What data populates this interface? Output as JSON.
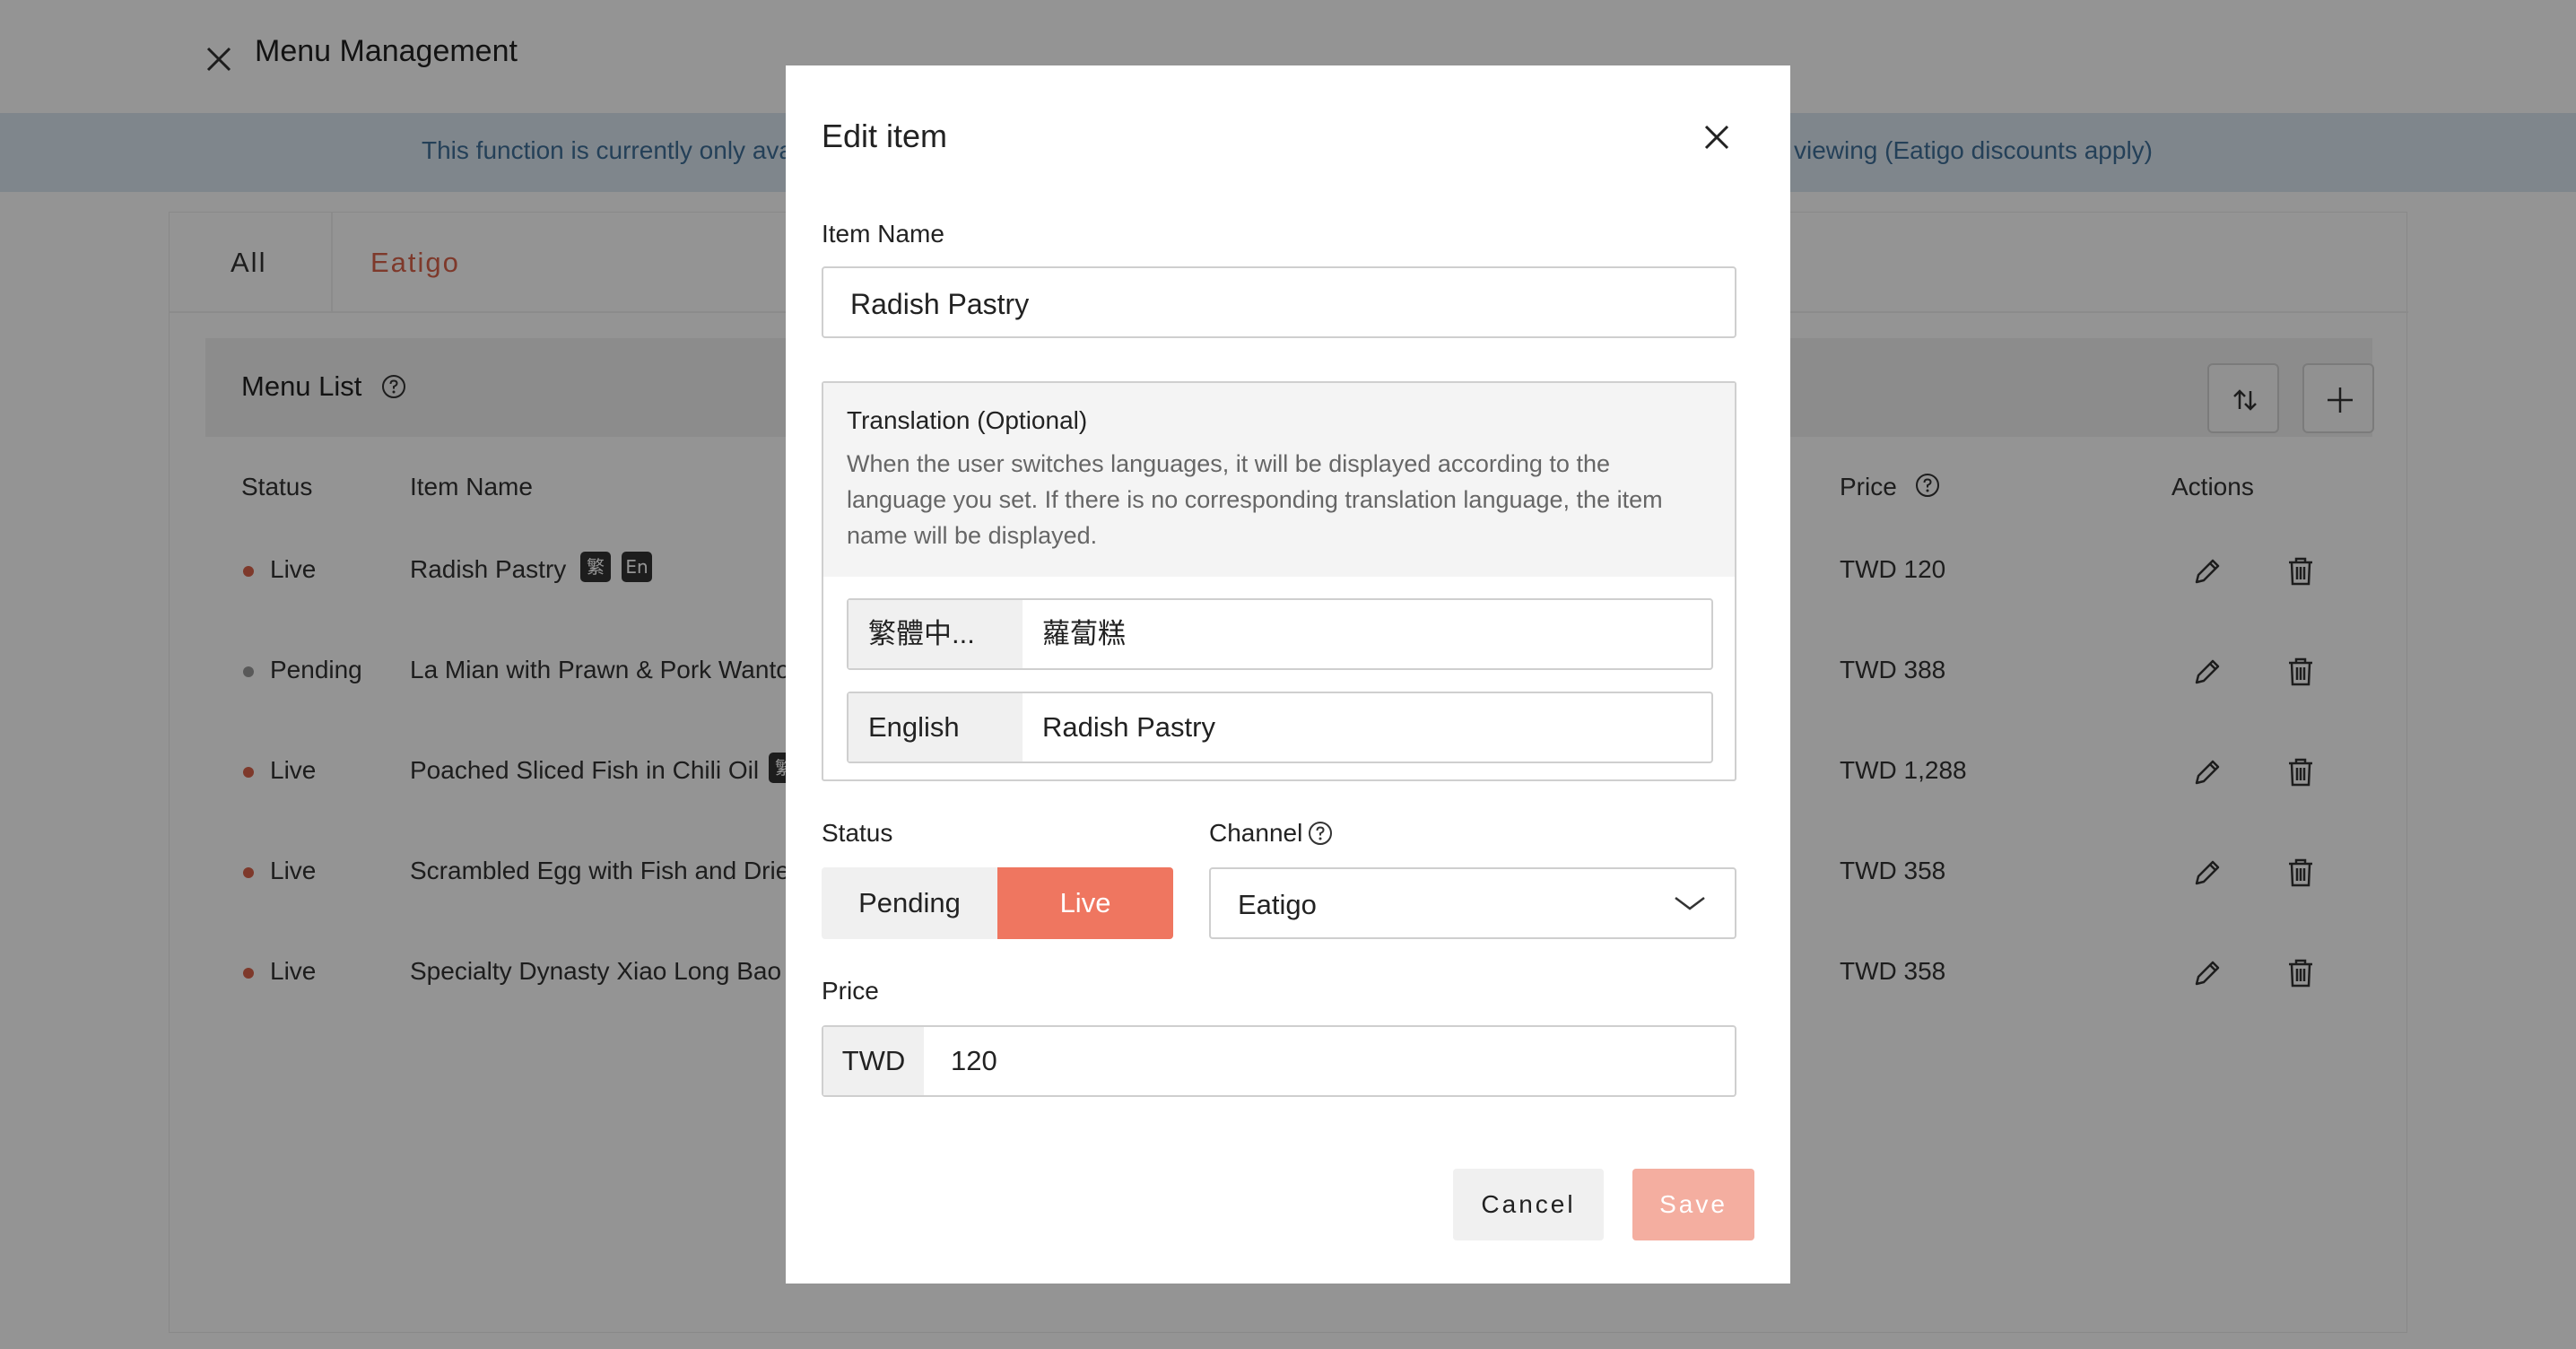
{
  "app": {
    "title": "Menu Management",
    "notice_left": "This function is currently only ava",
    "notice_right": "viewing (Eatigo discounts apply)"
  },
  "tabs": [
    {
      "label": "All"
    },
    {
      "label": "Eatigo"
    }
  ],
  "menu_list": {
    "label": "Menu List",
    "columns": {
      "status": "Status",
      "item_name": "Item Name",
      "price": "Price",
      "actions": "Actions"
    },
    "rows": [
      {
        "status": "Live",
        "name": "Radish Pastry",
        "price": "TWD 120",
        "badges": [
          "繁",
          "En"
        ]
      },
      {
        "status": "Pending",
        "name": "La Mian with Prawn & Pork Wanto",
        "price": "TWD 388",
        "badges": []
      },
      {
        "status": "Live",
        "name": "Poached Sliced Fish in Chili Oil",
        "price": "TWD 1,288",
        "badges": [
          "繁"
        ]
      },
      {
        "status": "Live",
        "name": "Scrambled Egg with Fish and Dried",
        "price": "TWD 358",
        "badges": []
      },
      {
        "status": "Live",
        "name": "Specialty Dynasty Xiao Long Bao (",
        "price": "TWD 358",
        "badges": []
      }
    ]
  },
  "modal": {
    "title": "Edit item",
    "item_name_label": "Item Name",
    "item_name_value": "Radish Pastry",
    "translation": {
      "title": "Translation (Optional)",
      "description": "When the user switches languages, it will be displayed according to the language you set. If there is no corresponding translation language, the item name will be displayed.",
      "entries": [
        {
          "language": "繁體中...",
          "value": "蘿蔔糕"
        },
        {
          "language": "English",
          "value": "Radish Pastry"
        }
      ]
    },
    "status_label": "Status",
    "status_options": [
      "Pending",
      "Live"
    ],
    "status_selected": "Live",
    "channel_label": "Channel",
    "channel_value": "Eatigo",
    "price_label": "Price",
    "currency": "TWD",
    "price_value": "120",
    "cancel_label": "Cancel",
    "save_label": "Save"
  },
  "colors": {
    "accent": "#ef7660",
    "accent_disabled": "#f4aea0",
    "tab_active": "#d9624a",
    "live_dot": "#d9624a",
    "pending_dot": "#9a9a9a",
    "notice_bg": "#dbe7f2",
    "notice_text": "#3f6f98"
  },
  "icons": [
    "close-icon",
    "help-icon",
    "sort-icon",
    "plus-icon",
    "edit-icon",
    "trash-icon",
    "chevron-down-icon"
  ]
}
